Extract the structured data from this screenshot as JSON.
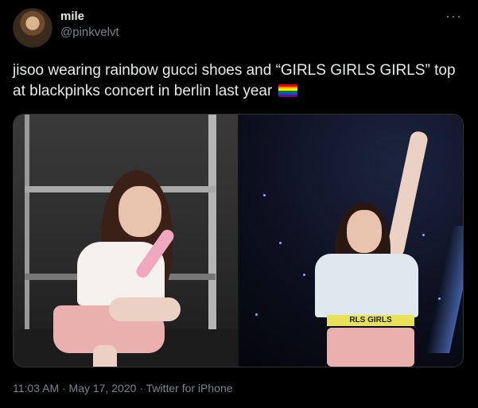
{
  "author": {
    "display_name": "mile",
    "handle": "@pinkvelvt"
  },
  "tweet": {
    "text": "jisoo wearing rainbow gucci shoes and “GIRLS GIRLS GIRLS” top at blackpinks concert in berlin last year",
    "emoji": "rainbow-flag-icon",
    "more_label": "···",
    "timestamp": "11:03 AM · May 17, 2020 · Twitter for iPhone"
  },
  "media": {
    "photos": [
      {
        "name": "photo-jisoo-crouching"
      },
      {
        "name": "photo-jisoo-concert"
      }
    ],
    "shirt_print": "RLS GIRLS"
  },
  "colors": {
    "background": "#000000",
    "text": "#e7e9ea",
    "muted": "#7d838a",
    "border": "#2f3336"
  }
}
